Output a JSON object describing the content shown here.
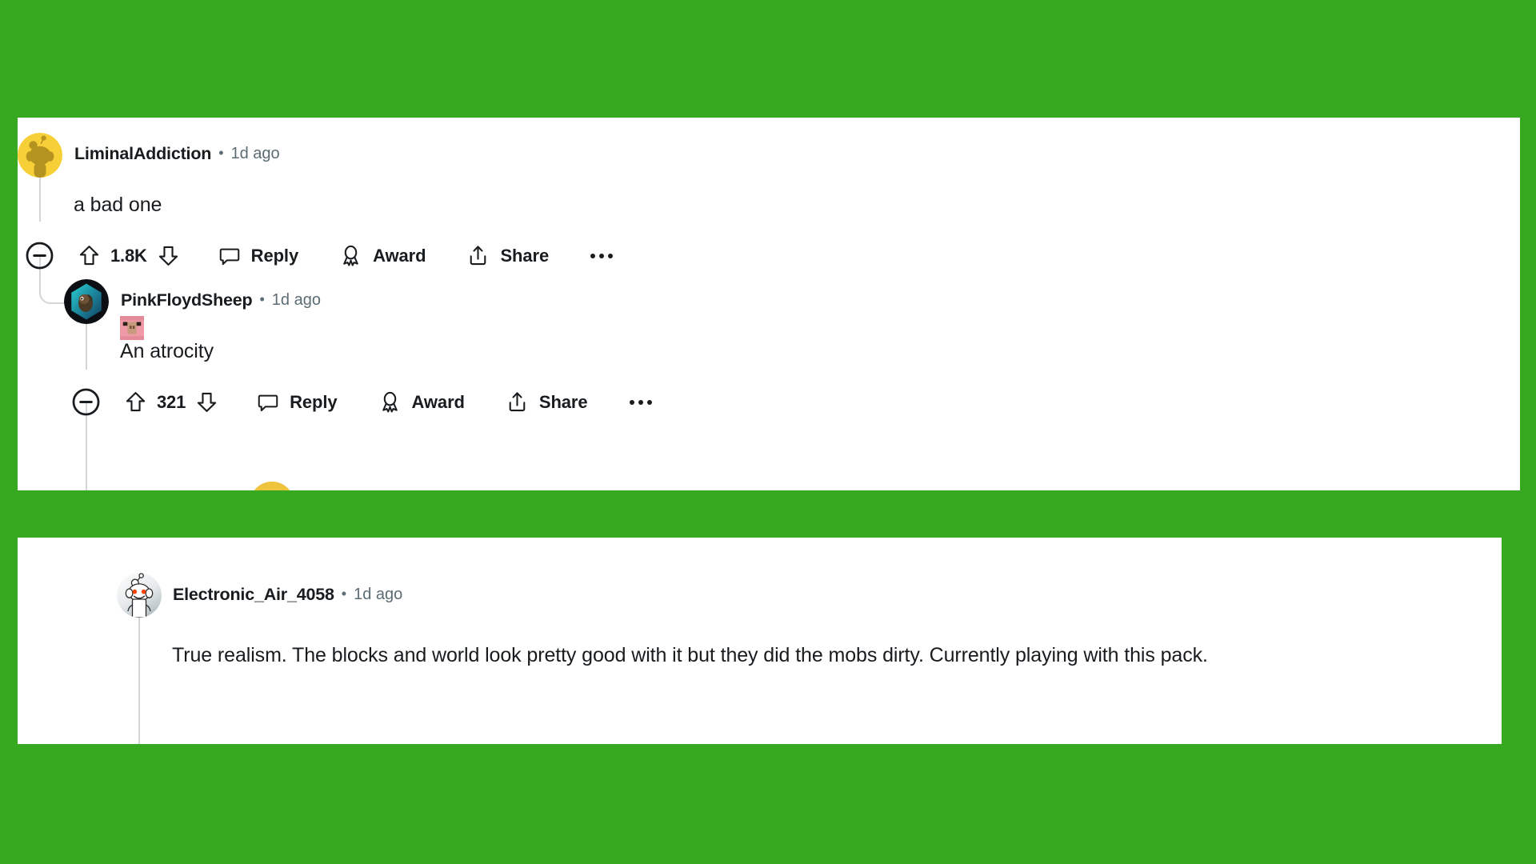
{
  "page": {
    "background_color": "#36a921",
    "card_background": "#ffffff"
  },
  "cards": [
    {
      "id": "comment-thread-card",
      "comments": [
        {
          "id": "comment-liminaladdiction",
          "username": "LiminalAddiction",
          "separator": "•",
          "timestamp": "1d ago",
          "body": "a bad one",
          "avatar": "snoo-yellow-avatar",
          "actions": {
            "collapse": "collapse-icon",
            "upvote": "upvote-arrow-icon",
            "vote_count": "1.8K",
            "downvote": "downvote-arrow-icon",
            "reply_icon": "comment-bubble-icon",
            "reply_label": "Reply",
            "award_icon": "award-ribbon-icon",
            "award_label": "Award",
            "share_icon": "share-upload-icon",
            "share_label": "Share",
            "more": "more-options-icon"
          }
        },
        {
          "id": "comment-pinkfloydsheep",
          "username": "PinkFloydSheep",
          "separator": "•",
          "timestamp": "1d ago",
          "body": "An atrocity",
          "emoji": "minecraft-pig-face",
          "avatar": "hexagon-teal-avatar",
          "actions": {
            "collapse": "collapse-icon",
            "upvote": "upvote-arrow-icon",
            "vote_count": "321",
            "downvote": "downvote-arrow-icon",
            "reply_icon": "comment-bubble-icon",
            "reply_label": "Reply",
            "award_icon": "award-ribbon-icon",
            "award_label": "Award",
            "share_icon": "share-upload-icon",
            "share_label": "Share",
            "more": "more-options-icon"
          }
        }
      ]
    },
    {
      "id": "comment-standalone-card",
      "comments": [
        {
          "id": "comment-electronic-air",
          "username": "Electronic_Air_4058",
          "separator": "•",
          "timestamp": "1d ago",
          "body": "True realism. The blocks and world look pretty good with it but they did the mobs dirty. Currently playing with this pack.",
          "avatar": "snoo-white-avatar"
        }
      ]
    }
  ]
}
